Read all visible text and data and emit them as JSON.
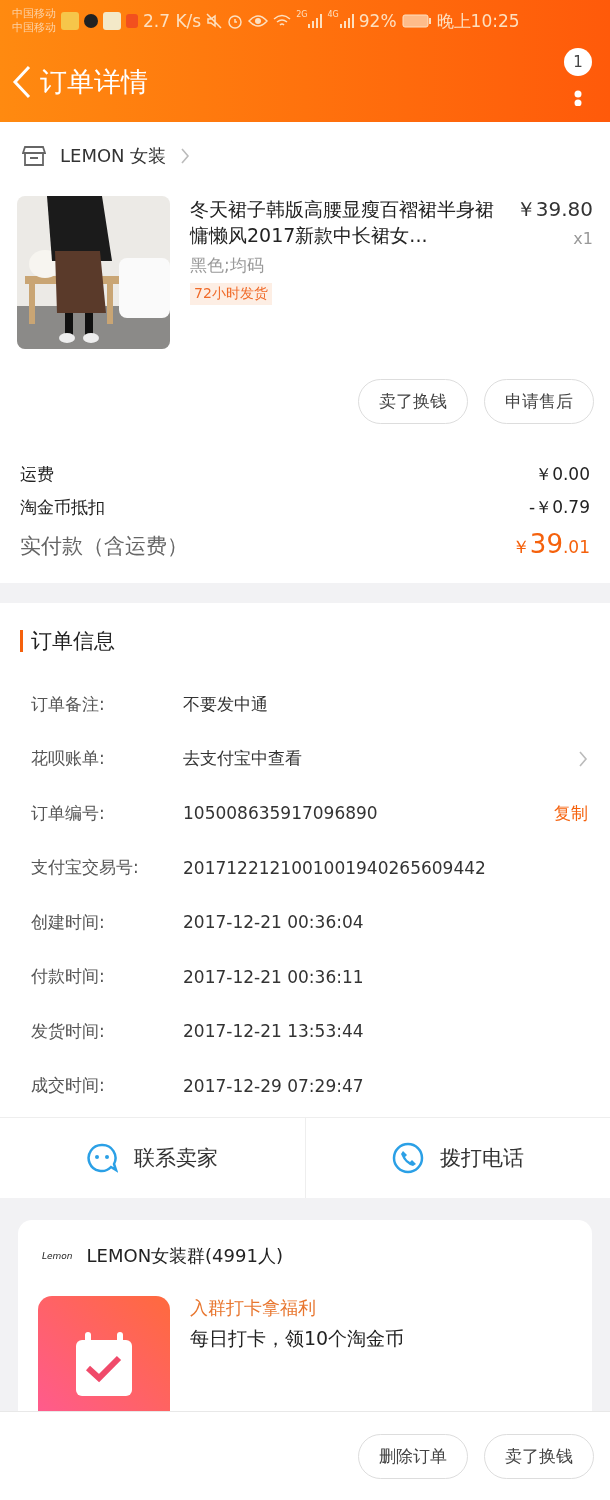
{
  "status_bar": {
    "carriers": [
      "中国移动",
      "中国移动"
    ],
    "speed": "2.7 K/s",
    "networks": [
      "2G",
      "4G"
    ],
    "battery": "92%",
    "time": "晚上10:25"
  },
  "header": {
    "title": "订单详情",
    "badge": "1"
  },
  "store": {
    "name": "LEMON 女装"
  },
  "product": {
    "title": "冬天裙子韩版高腰显瘦百褶裙半身裙慵懒风2017新款中长裙女...",
    "price": "￥39.80",
    "quantity": "x1",
    "spec": "黑色;均码",
    "tag": "72小时发货"
  },
  "item_actions": [
    "卖了换钱",
    "申请售后"
  ],
  "costs": [
    {
      "label": "运费",
      "value": "￥0.00"
    },
    {
      "label": "淘金币抵扣",
      "value": "-￥0.79"
    }
  ],
  "total": {
    "label": "实付款（含运费）",
    "currency": "￥",
    "integer": "39",
    "decimal": ".01"
  },
  "order_info": {
    "title": "订单信息",
    "rows": [
      {
        "kind": "text",
        "label": "订单备注:",
        "value": "不要发中通"
      },
      {
        "kind": "link",
        "label": "花呗账单:",
        "value": "去支付宝中查看"
      },
      {
        "kind": "copy",
        "label": "订单编号:",
        "value": "105008635917096890",
        "action": "复制"
      },
      {
        "kind": "text",
        "label": "支付宝交易号:",
        "value": "2017122121001001940265609442"
      },
      {
        "kind": "text",
        "label": "创建时间:",
        "value": "2017-12-21 00:36:04"
      },
      {
        "kind": "text",
        "label": "付款时间:",
        "value": "2017-12-21 00:36:11"
      },
      {
        "kind": "text",
        "label": "发货时间:",
        "value": "2017-12-21 13:53:44"
      },
      {
        "kind": "text",
        "label": "成交时间:",
        "value": "2017-12-29 07:29:47"
      }
    ]
  },
  "contact": [
    {
      "kind": "chat",
      "label": "联系卖家"
    },
    {
      "kind": "phone",
      "label": "拨打电话"
    }
  ],
  "group": {
    "logo": "Lemon",
    "name": "LEMON女装群(4991人)",
    "promo_title": "入群打卡拿福利",
    "promo_text": "每日打卡，领10个淘金币"
  },
  "bottom_buttons": [
    "删除订单",
    "卖了换钱"
  ]
}
